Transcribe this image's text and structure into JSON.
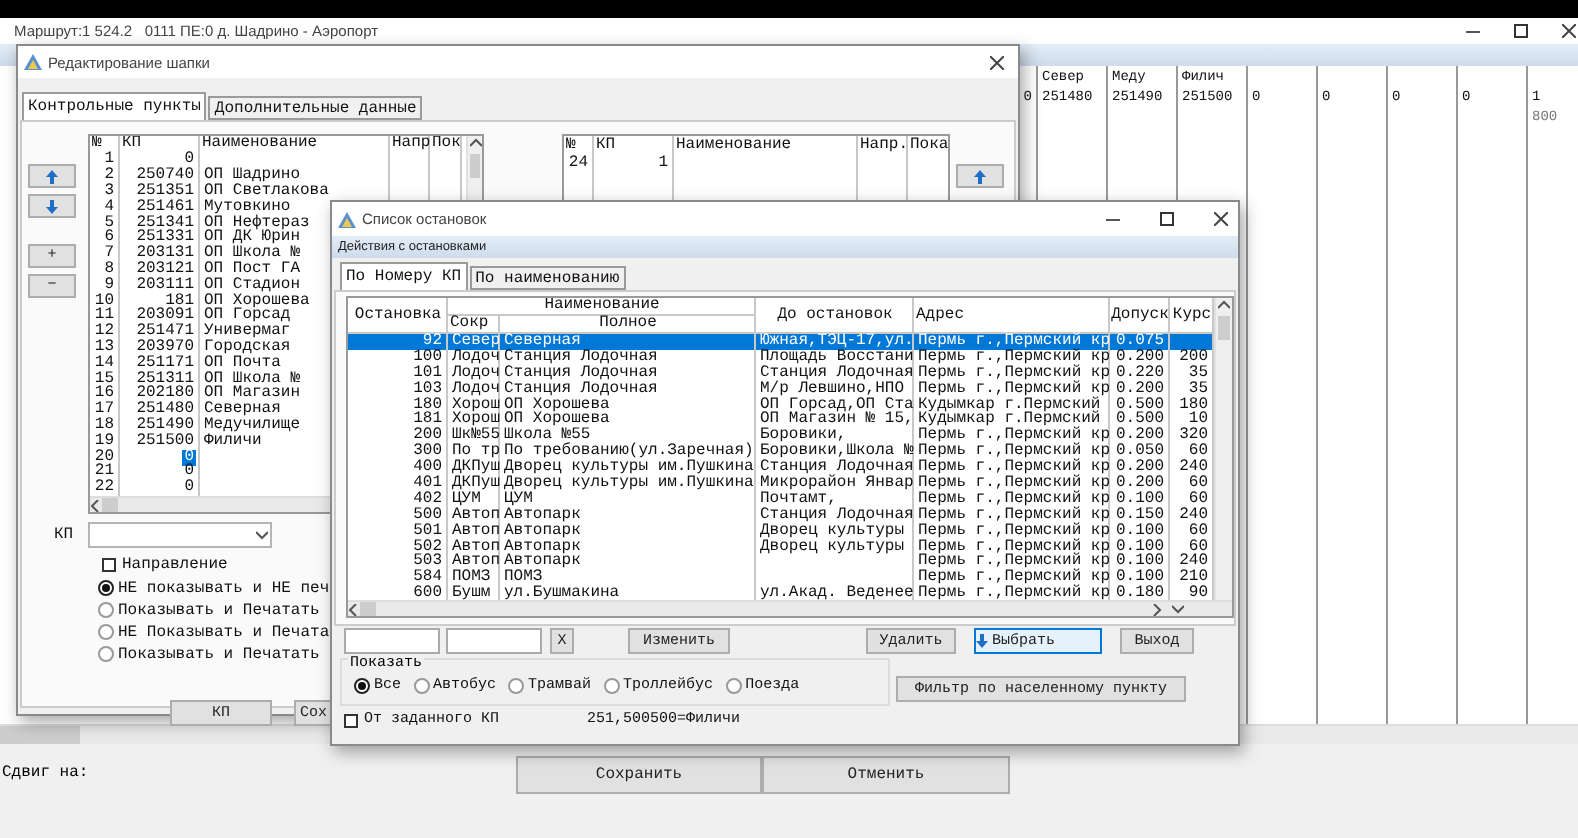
{
  "main_window": {
    "title": "Маршрут:1 524.2   0111 ПЕ:0 д. Шадрино - Аэропорт",
    "grid_columns": [
      {
        "value": "0"
      },
      {
        "header": "Север",
        "value": "251480"
      },
      {
        "header": "Меду",
        "value": "251490"
      },
      {
        "header": "Филич",
        "value": "251500"
      },
      {
        "value": "0"
      },
      {
        "value": "0"
      },
      {
        "value": "0"
      },
      {
        "value": "0"
      },
      {
        "value": "1",
        "subvalue": "800"
      }
    ],
    "shift_label": "Сдвиг на:",
    "buttons": [
      "Сохранить",
      "Отменить"
    ]
  },
  "header_dialog": {
    "title": "Редактирование шапки",
    "tabs": [
      {
        "label": "Контрольные пункты",
        "selected": true
      },
      {
        "label": "Дополнительные данные",
        "selected": false
      }
    ],
    "side_buttons": [
      "+",
      "−"
    ],
    "control_points": {
      "columns": [
        "№",
        "КП",
        "Наименование",
        "Напр",
        "Пок"
      ],
      "rows": [
        {
          "n": "1",
          "kp": "0",
          "selected": false
        },
        {
          "n": "2",
          "kp": "250740",
          "name": "ОП Шадрино",
          "selected": false
        },
        {
          "n": "3",
          "kp": "251351",
          "name": "ОП Светлакова",
          "selected": false
        },
        {
          "n": "4",
          "kp": "251461",
          "name": "Мутовкино",
          "selected": false
        },
        {
          "n": "5",
          "kp": "251341",
          "name": "ОП Нефтераз",
          "selected": false
        },
        {
          "n": "6",
          "kp": "251331",
          "name": "ОП ДК Юрин",
          "selected": false
        },
        {
          "n": "7",
          "kp": "203131",
          "name": "ОП Школа №",
          "selected": false
        },
        {
          "n": "8",
          "kp": "203121",
          "name": "ОП Пост ГА",
          "selected": false
        },
        {
          "n": "9",
          "kp": "203111",
          "name": "ОП Стадион",
          "selected": false
        },
        {
          "n": "10",
          "kp": "181",
          "name": "ОП Хорошева",
          "selected": false
        },
        {
          "n": "11",
          "kp": "203091",
          "name": "ОП Горсад",
          "selected": false
        },
        {
          "n": "12",
          "kp": "251471",
          "name": "Универмаг",
          "selected": false
        },
        {
          "n": "13",
          "kp": "203970",
          "name": "Городская",
          "selected": false
        },
        {
          "n": "14",
          "kp": "251171",
          "name": "ОП Почта",
          "selected": false
        },
        {
          "n": "15",
          "kp": "251311",
          "name": "ОП Школа №",
          "selected": false
        },
        {
          "n": "16",
          "kp": "202180",
          "name": "ОП Магазин",
          "selected": false
        },
        {
          "n": "17",
          "kp": "251480",
          "name": "Северная",
          "selected": false
        },
        {
          "n": "18",
          "kp": "251490",
          "name": "Медучилище",
          "selected": false
        },
        {
          "n": "19",
          "kp": "251500",
          "name": "Филичи",
          "selected": false
        },
        {
          "n": "20",
          "kp": "0",
          "selected": true
        },
        {
          "n": "21",
          "kp": "0",
          "selected": false
        },
        {
          "n": "22",
          "kp": "0",
          "selected": false
        }
      ]
    },
    "route_points": {
      "columns": [
        "№",
        "КП",
        "Наименование",
        "Напр.",
        "Пока"
      ],
      "rows": [
        {
          "n": "24",
          "kp": "1"
        }
      ]
    },
    "kp_label": "КП",
    "direction": {
      "label": "Направление",
      "checked": false
    },
    "print_options": [
      {
        "label": "НЕ показывать и НЕ печ",
        "selected": true
      },
      {
        "label": "Показывать и Печатать",
        "selected": false
      },
      {
        "label": "НЕ Показывать и Печата",
        "selected": false
      },
      {
        "label": "Показывать и Печатать",
        "selected": false
      }
    ],
    "buttons": [
      "КП",
      "Сох"
    ]
  },
  "stops_dialog": {
    "title": "Список остановок",
    "section": "Действия с остановками",
    "tabs": [
      {
        "label": "По Номеру КП",
        "selected": true
      },
      {
        "label": "По наименованию",
        "selected": false
      }
    ],
    "group_header": "Наименование",
    "columns": [
      "Остановка",
      "Сокр",
      "Полное",
      "До остановок",
      "Адрес",
      "Допуск",
      "Курс"
    ],
    "rows": [
      {
        "kp": "92",
        "short": "Север",
        "full": "Северная",
        "next": "Южная,ТЭЦ-17,ул.",
        "address": "Пермь г.,Пермский кр",
        "tolerance": "0.075",
        "selected": true
      },
      {
        "kp": "100",
        "short": "Лодоч",
        "full": "Станция Лодочная",
        "next": "Площадь Восстани",
        "address": "Пермь г.,Пермский кр",
        "tolerance": "0.200",
        "course": "200",
        "selected": false
      },
      {
        "kp": "101",
        "short": "Лодоч",
        "full": "Станция Лодочная",
        "next": "Станция Лодочная",
        "address": "Пермь г.,Пермский кр",
        "tolerance": "0.220",
        "course": "35",
        "selected": false
      },
      {
        "kp": "103",
        "short": "Лодоч",
        "full": "Станция Лодочная",
        "next": "М/р Левшино,НПО",
        "address": "Пермь г.,Пермский кр",
        "tolerance": "0.200",
        "course": "35",
        "selected": false
      },
      {
        "kp": "180",
        "short": "Хорош",
        "full": "ОП Хорошева",
        "next": "ОП Горсад,ОП Ста",
        "address": "Кудымкар г.Пермский",
        "tolerance": "0.500",
        "course": "180",
        "selected": false
      },
      {
        "kp": "181",
        "short": "Хорош",
        "full": "ОП Хорошева",
        "next": "ОП Магазин № 15,",
        "address": "Кудымкар г.Пермский",
        "tolerance": "0.500",
        "course": "10",
        "selected": false
      },
      {
        "kp": "200",
        "short": "Шк№55",
        "full": "Школа №55",
        "next": "Боровики,",
        "address": "Пермь г.,Пермский кр",
        "tolerance": "0.200",
        "course": "320",
        "selected": false
      },
      {
        "kp": "300",
        "short": "По тр",
        "full": "По требованию(ул.Заречная)",
        "next": "Боровики,Школа №",
        "address": "Пермь г.,Пермский кр",
        "tolerance": "0.050",
        "course": "60",
        "selected": false
      },
      {
        "kp": "400",
        "short": "ДКПуш",
        "full": "Дворец культуры им.Пушкина",
        "next": "Станция Лодочная",
        "address": "Пермь г.,Пермский кр",
        "tolerance": "0.200",
        "course": "240",
        "selected": false
      },
      {
        "kp": "401",
        "short": "ДКПуш",
        "full": "Дворец культуры им.Пушкина",
        "next": "Микрорайон Январ",
        "address": "Пермь г.,Пермский кр",
        "tolerance": "0.200",
        "course": "60",
        "selected": false
      },
      {
        "kp": "402",
        "short": "ЦУМ",
        "full": "ЦУМ",
        "next": "Почтамт,",
        "address": "Пермь г.,Пермский кр",
        "tolerance": "0.100",
        "course": "60",
        "selected": false
      },
      {
        "kp": "500",
        "short": "Автоп",
        "full": "Автопарк",
        "next": "Станция Лодочная",
        "address": "Пермь г.,Пермский кр",
        "tolerance": "0.150",
        "course": "240",
        "selected": false
      },
      {
        "kp": "501",
        "short": "Автоп",
        "full": "Автопарк",
        "next": "Дворец культуры",
        "address": "Пермь г.,Пермский кр",
        "tolerance": "0.100",
        "course": "60",
        "selected": false
      },
      {
        "kp": "502",
        "short": "Автоп",
        "full": "Автопарк",
        "next": "Дворец культуры",
        "address": "Пермь г.,Пермский кр",
        "tolerance": "0.100",
        "course": "60",
        "selected": false
      },
      {
        "kp": "503",
        "short": "Автоп",
        "full": "Автопарк",
        "address": "Пермь г.,Пермский кр",
        "tolerance": "0.100",
        "course": "240",
        "selected": false
      },
      {
        "kp": "584",
        "short": "ПОМЗ",
        "full": "ПОМЗ",
        "address": "Пермь г.,Пермский кр",
        "tolerance": "0.100",
        "course": "210",
        "selected": false
      },
      {
        "kp": "600",
        "short": "Бушм",
        "full": "ул.Бушмакина",
        "next": "ул.Акад. Веденее",
        "address": "Пермь г.,Пермский кр",
        "tolerance": "0.180",
        "course": "90",
        "selected": false
      }
    ],
    "clear_button": "X",
    "actions": [
      {
        "label": "Изменить",
        "default": false
      },
      {
        "label": "Удалить",
        "default": false
      },
      {
        "label": "Выбрать",
        "default": true
      },
      {
        "label": "Выход",
        "default": false
      }
    ],
    "show_group": {
      "title": "Показать",
      "options": [
        {
          "label": "Все",
          "selected": true
        },
        {
          "label": "Автобус",
          "selected": false
        },
        {
          "label": "Трамвай",
          "selected": false
        },
        {
          "label": "Троллейбус",
          "selected": false
        },
        {
          "label": "Поезда",
          "selected": false
        }
      ]
    },
    "filter_button": "Фильтр по населенному пункту",
    "from_kp": {
      "label": "От заданного КП",
      "checked": false
    },
    "current_stop": "251,500500=Филичи"
  }
}
